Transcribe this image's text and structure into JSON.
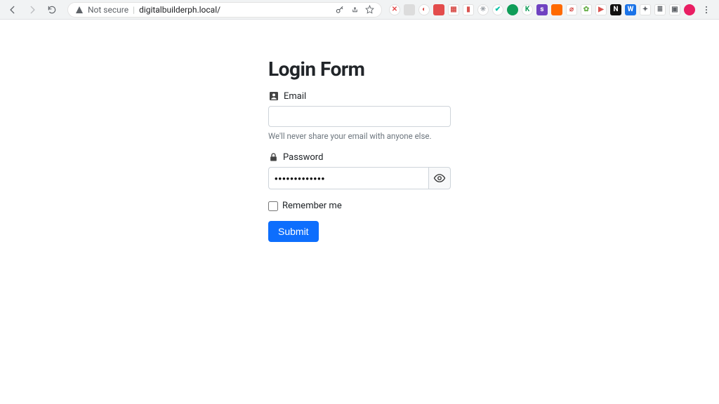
{
  "browser": {
    "url_security_label": "Not secure",
    "url": "digitalbuilderph.local/",
    "extensions": [
      {
        "name": "ext-close",
        "bg": "#ffffff",
        "fg": "#e34c4c",
        "glyph": "✕",
        "round": true
      },
      {
        "name": "ext-square-gray1",
        "bg": "#dcdcdc",
        "fg": "#888",
        "glyph": ""
      },
      {
        "name": "ext-half-circle",
        "bg": "#ffffff",
        "fg": "#d9534f",
        "glyph": "◐",
        "round": true
      },
      {
        "name": "ext-red-square",
        "bg": "#e34c4c",
        "fg": "#fff",
        "glyph": ""
      },
      {
        "name": "ext-calendar",
        "bg": "#ffffff",
        "fg": "#d9534f",
        "glyph": "▦"
      },
      {
        "name": "ext-red-shield",
        "bg": "#ffffff",
        "fg": "#d9534f",
        "glyph": "▮"
      },
      {
        "name": "ext-gray-gear",
        "bg": "#ffffff",
        "fg": "#9aa0a6",
        "glyph": "✳",
        "round": true
      },
      {
        "name": "ext-teal-check",
        "bg": "#ffffff",
        "fg": "#00bfa5",
        "glyph": "✔",
        "round": true
      },
      {
        "name": "ext-green-circle",
        "bg": "#0f9d58",
        "fg": "#fff",
        "glyph": "",
        "round": true
      },
      {
        "name": "ext-green-k",
        "bg": "#ffffff",
        "fg": "#0f9d58",
        "glyph": "K",
        "round": true
      },
      {
        "name": "ext-purple-s",
        "bg": "#6f42c1",
        "fg": "#fff",
        "glyph": "s"
      },
      {
        "name": "ext-orange-square",
        "bg": "#ff6a00",
        "fg": "#fff",
        "glyph": ""
      },
      {
        "name": "ext-red-slash",
        "bg": "#ffffff",
        "fg": "#d9534f",
        "glyph": "⌀"
      },
      {
        "name": "ext-green-leaf",
        "bg": "#ffffff",
        "fg": "#6ab04c",
        "glyph": "✿"
      },
      {
        "name": "ext-red-play",
        "bg": "#ffffff",
        "fg": "#d9534f",
        "glyph": "▶"
      },
      {
        "name": "ext-black-n",
        "bg": "#111",
        "fg": "#fff",
        "glyph": "N"
      },
      {
        "name": "ext-blue-w",
        "bg": "#1a73e8",
        "fg": "#fff",
        "glyph": "W"
      },
      {
        "name": "ext-puzzle",
        "bg": "#ffffff",
        "fg": "#5f6368",
        "glyph": "✦"
      },
      {
        "name": "ext-list",
        "bg": "#ffffff",
        "fg": "#5f6368",
        "glyph": "≣"
      },
      {
        "name": "ext-panel",
        "bg": "#ffffff",
        "fg": "#5f6368",
        "glyph": "▣"
      },
      {
        "name": "ext-avatar",
        "bg": "#e91e63",
        "fg": "#fff",
        "glyph": "",
        "round": true
      }
    ]
  },
  "form": {
    "title": "Login Form",
    "email": {
      "label": "Email",
      "value": "",
      "help": "We'll never share your email with anyone else."
    },
    "password": {
      "label": "Password",
      "value": "•••••••••••••"
    },
    "remember": {
      "label": "Remember me",
      "checked": false
    },
    "submit_label": "Submit"
  }
}
